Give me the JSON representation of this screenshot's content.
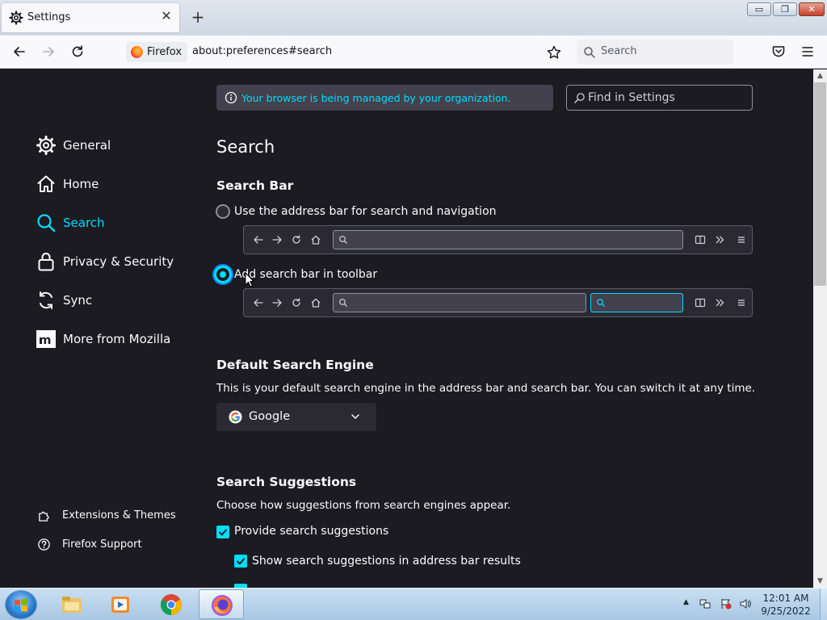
{
  "tab": {
    "title": "Settings",
    "close": "✕"
  },
  "new_tab": "+",
  "window_controls": {
    "minimize": "▭",
    "maximize": "❐",
    "close": "✕"
  },
  "navbar": {
    "identity_label": "Firefox",
    "url": "about:preferences#search",
    "search_placeholder": "Search"
  },
  "policy_notice": "Your browser is being managed by your organization.",
  "find_placeholder": "Find in Settings",
  "sidebar": {
    "items": [
      {
        "label": "General",
        "icon": "gear-icon"
      },
      {
        "label": "Home",
        "icon": "home-icon"
      },
      {
        "label": "Search",
        "icon": "search-icon",
        "selected": true
      },
      {
        "label": "Privacy & Security",
        "icon": "lock-icon"
      },
      {
        "label": "Sync",
        "icon": "sync-icon"
      },
      {
        "label": "More from Mozilla",
        "icon": "mozilla-icon"
      }
    ],
    "footer": [
      {
        "label": "Extensions & Themes",
        "icon": "puzzle-icon"
      },
      {
        "label": "Firefox Support",
        "icon": "help-icon"
      }
    ]
  },
  "main": {
    "title": "Search",
    "search_bar": {
      "heading": "Search Bar",
      "option_address": "Use the address bar for search and navigation",
      "option_toolbar": "Add search bar in toolbar",
      "selected": "option_toolbar"
    },
    "default_engine": {
      "heading": "Default Search Engine",
      "description": "This is your default search engine in the address bar and search bar. You can switch it at any time.",
      "selected": "Google"
    },
    "suggestions": {
      "heading": "Search Suggestions",
      "description": "Choose how suggestions from search engines appear.",
      "provide": {
        "label": "Provide search suggestions",
        "checked": true
      },
      "address_bar": {
        "label": "Show search suggestions in address bar results",
        "checked": true
      }
    }
  },
  "taskbar": {
    "apps": [
      "file-explorer-icon",
      "media-player-icon",
      "chrome-icon",
      "firefox-icon"
    ],
    "time": "12:01 AM",
    "date": "9/25/2022"
  },
  "colors": {
    "accent": "#00ddff",
    "background": "#1c1b22",
    "surface": "#2b2a33"
  }
}
